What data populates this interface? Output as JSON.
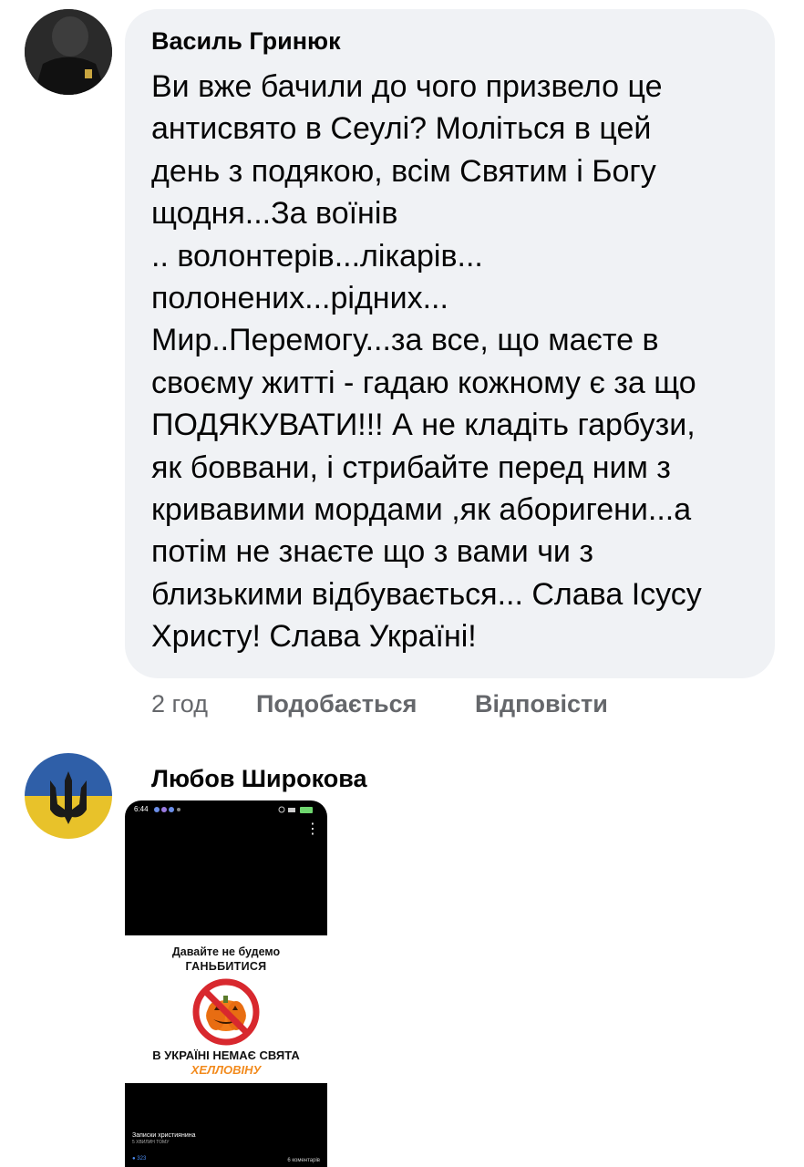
{
  "comments": [
    {
      "author": "Василь Гринюк",
      "lines": [
        "Ви вже бачили до чого призвело це",
        "антисвято в Сеулі? Моліться в цей",
        "день з подякою, всім Святим і Богу",
        "щодня...За воїнів",
        ".. волонтерів...лікарів...",
        "полонених...рідних...",
        "Мир..Перемогу...за все, що маєте в",
        "своєму житті - гадаю кожному є за що",
        "ПОДЯКУВАТИ!!! А не кладіть гарбузи,",
        "як боввани, і стрибайте перед ним з",
        "кривавими мордами ,як аборигени...а",
        "потім не знаєте що з вами чи з",
        "близькими відбувається... Слава Ісусу",
        "Христу! Слава Україні!"
      ],
      "time": "2 год",
      "like_label": "Подобається",
      "reply_label": "Відповісти"
    },
    {
      "author": "Любов Широкова"
    }
  ],
  "attachment": {
    "status_time": "6:44",
    "poster_line1": "Давайте не будемо",
    "poster_line2": "ГАНЬБИТИСЯ",
    "poster_line3": "В УКРАЇНІ НЕМАЄ СВЯТА",
    "poster_line4": "ХЕЛЛОВІНУ",
    "page_name": "Записки християнина",
    "page_time": "5 ХВИЛИН ТОМУ",
    "reactions": "323",
    "comments_count": "6 коментарів"
  },
  "colors": {
    "bubble": "#f0f2f5",
    "text": "#050505",
    "secondary": "#65676b",
    "poster_accent": "#f28a1c",
    "ban_red": "#d8282e"
  }
}
